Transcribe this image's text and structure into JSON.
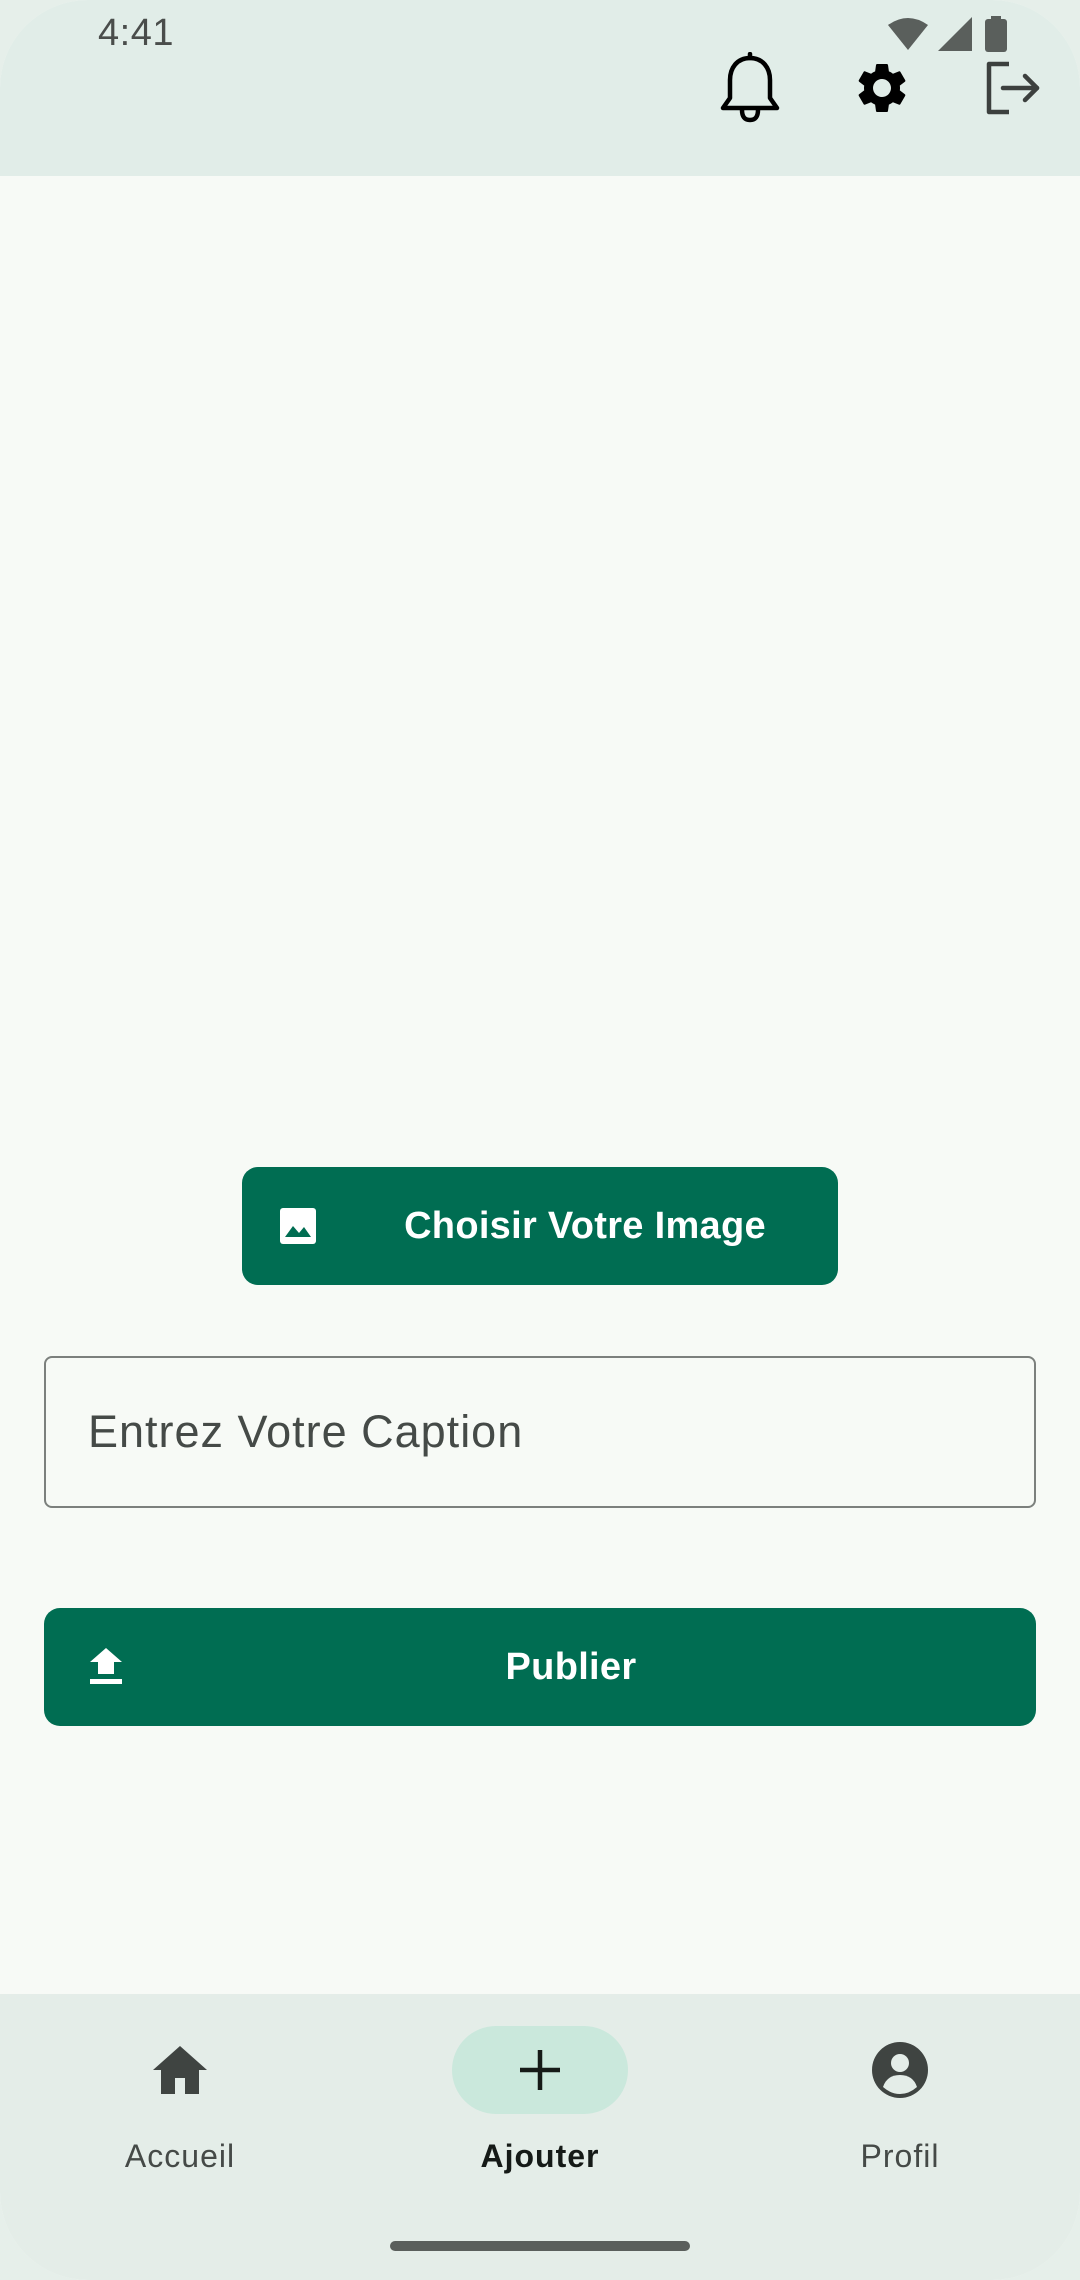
{
  "status_bar": {
    "time": "4:41",
    "icons": [
      "wifi-icon",
      "cell-signal-icon",
      "battery-icon"
    ]
  },
  "app_bar": {
    "actions": [
      "bell-icon",
      "gear-icon",
      "logout-icon"
    ]
  },
  "main": {
    "choose_image_label": "Choisir Votre Image",
    "choose_image_icon": "image-icon",
    "caption_placeholder": "Entrez Votre Caption",
    "caption_value": "",
    "publish_label": "Publier",
    "publish_icon": "upload-icon"
  },
  "bottom_nav": {
    "items": [
      {
        "label": "Accueil",
        "icon": "home-icon",
        "selected": false
      },
      {
        "label": "Ajouter",
        "icon": "plus-icon",
        "selected": true
      },
      {
        "label": "Profil",
        "icon": "account-circle-icon",
        "selected": false
      }
    ]
  },
  "colors": {
    "primary": "#006d52",
    "app_bar_bg": "#e1ede8",
    "surface": "#f7faf6",
    "nav_indicator": "#cae8dc"
  }
}
